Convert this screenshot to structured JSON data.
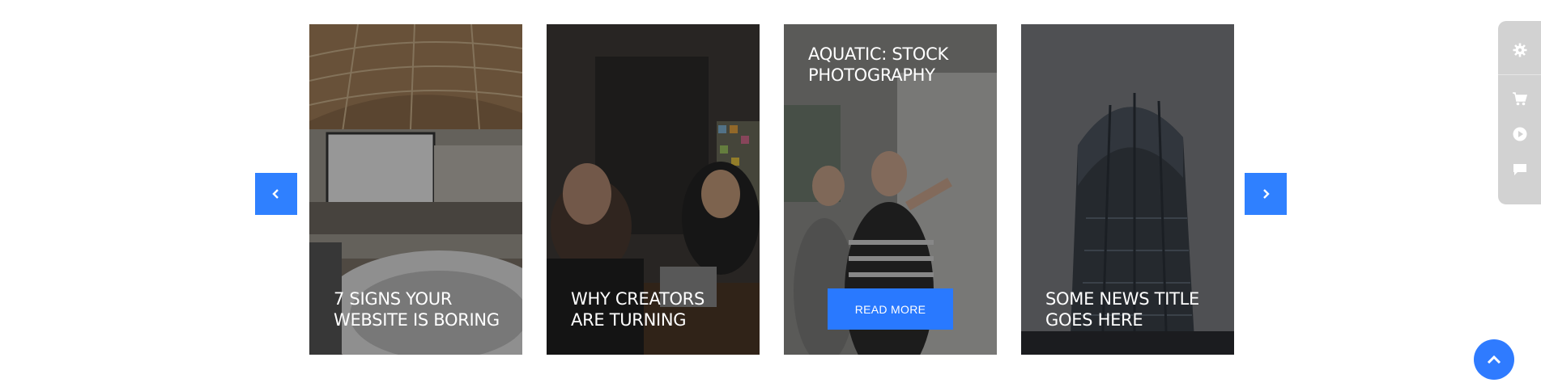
{
  "carousel": {
    "prev_icon": "chevron-left-icon",
    "next_icon": "chevron-right-icon",
    "accent_color": "#2f80ff",
    "cards": [
      {
        "title": "7 SIGNS YOUR WEBSITE IS BORING",
        "image": "conference-hall-photo"
      },
      {
        "title": "WHY CREATORS ARE TURNING",
        "image": "office-meeting-photo"
      },
      {
        "title": "AQUATIC: STOCK PHOTOGRAPHY",
        "image": "whiteboard-team-photo",
        "button_label": "READ MORE"
      },
      {
        "title": "SOME NEWS TITLE GOES HERE",
        "image": "skyscraper-photo"
      }
    ]
  },
  "side_panel": {
    "items": [
      "gear-icon",
      "cart-icon",
      "play-icon",
      "chat-icon"
    ]
  },
  "scroll_top": {
    "icon": "chevron-up-icon"
  }
}
